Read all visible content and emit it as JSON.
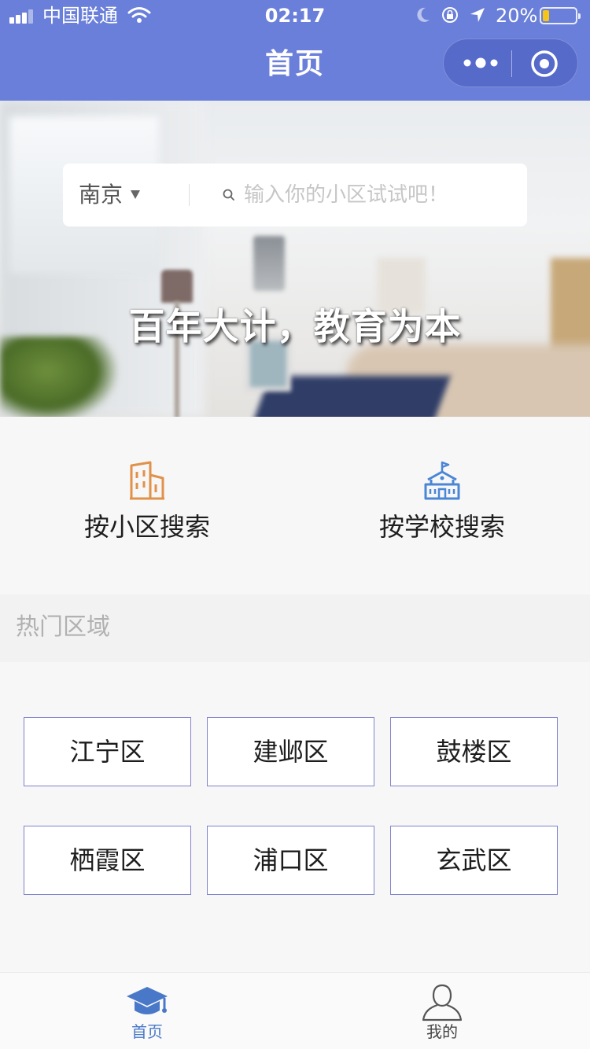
{
  "status_bar": {
    "carrier": "中国联通",
    "time": "02:17",
    "battery": "20%"
  },
  "nav": {
    "title": "首页"
  },
  "search": {
    "city": "南京",
    "placeholder": "输入你的小区试试吧！"
  },
  "hero": {
    "slogan": "百年大计，教育为本"
  },
  "options": [
    {
      "label": "按小区搜索",
      "icon": "building-icon"
    },
    {
      "label": "按学校搜索",
      "icon": "school-icon"
    }
  ],
  "hot_areas": {
    "title": "热门区域",
    "areas": [
      "江宁区",
      "建邺区",
      "鼓楼区",
      "栖霞区",
      "浦口区",
      "玄武区"
    ]
  },
  "tabbar": {
    "tabs": [
      {
        "label": "首页",
        "icon": "graduation-cap-icon",
        "active": true
      },
      {
        "label": "我的",
        "icon": "person-icon",
        "active": false
      }
    ]
  },
  "colors": {
    "nav_bg": "#6a7fd9",
    "accent": "#4a78c8",
    "area_border": "#7f83cc",
    "building_icon": "#e0914a",
    "school_icon": "#4a86d6"
  }
}
